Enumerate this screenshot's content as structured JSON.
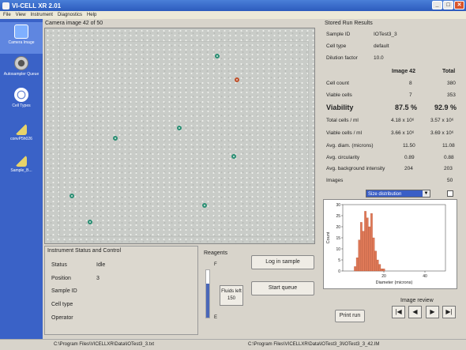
{
  "window": {
    "title": "VI-CELL XR 2.01"
  },
  "menu": [
    "File",
    "View",
    "Instrument",
    "Diagnostics",
    "Help"
  ],
  "sidebar": {
    "items": [
      {
        "label": "Camera Image",
        "color": "#7fb0ff"
      },
      {
        "label": "Autosampler Queue",
        "color": "#c9c9c9"
      },
      {
        "label": "Cell Types",
        "color": "#f0f0f0"
      },
      {
        "label": "convP5h026",
        "color": "#e8d36a"
      },
      {
        "label": "Sample_B...",
        "color": "#e8d36a"
      }
    ]
  },
  "camera": {
    "label": "Camera image 42 of 50"
  },
  "status": {
    "title": "Instrument Status and Control",
    "rows": [
      {
        "label": "Status",
        "value": "Idle"
      },
      {
        "label": "Position",
        "value": "3"
      },
      {
        "label": "Sample ID",
        "value": ""
      },
      {
        "label": "Cell type",
        "value": ""
      },
      {
        "label": "Operator",
        "value": ""
      }
    ]
  },
  "reagents": {
    "title": "Reagents",
    "full_mark": "F",
    "empty_mark": "E",
    "fluids_label": "Fluids left",
    "fluids_value": "150",
    "fluid_level": 0.72
  },
  "buttons": {
    "login": "Log in sample",
    "start": "Start queue",
    "print": "Print run"
  },
  "results": {
    "title": "Stored Run Results",
    "sample_id_label": "Sample ID",
    "sample_id": "IOTest3_3",
    "cell_type_label": "Cell type",
    "cell_type": "default",
    "dilution_label": "Dilution factor",
    "dilution": "10.0",
    "col_image": "Image 42",
    "col_total": "Total",
    "rows": [
      {
        "label": "Cell count",
        "image": "8",
        "total": "380"
      },
      {
        "label": "Viable cells",
        "image": "7",
        "total": "353"
      }
    ],
    "viability": {
      "label": "Viability",
      "image": "87.5 %",
      "total": "92.9 %"
    },
    "rows2": [
      {
        "label": "Total cells / ml",
        "image": "4.18 x 10⁶",
        "total": "3.57 x 10⁶"
      },
      {
        "label": "Viable cells / ml",
        "image": "3.66 x 10⁶",
        "total": "3.69 x 10⁶"
      },
      {
        "label": "Avg. diam. (microns)",
        "image": "11.50",
        "total": "11.08"
      },
      {
        "label": "Avg. circularity",
        "image": "0.89",
        "total": "0.88"
      },
      {
        "label": "Avg. background intensity",
        "image": "204",
        "total": "203"
      },
      {
        "label": "Images",
        "image": "",
        "total": "50"
      }
    ]
  },
  "histogram": {
    "selector": "Size distribution",
    "arrow": "▼"
  },
  "chart_data": {
    "type": "bar",
    "xlabel": "Diameter (microns)",
    "ylabel": "Count",
    "xlim": [
      0,
      50
    ],
    "ylim": [
      0,
      30
    ],
    "xticks": [
      20,
      40
    ],
    "yticks": [
      0,
      5,
      10,
      15,
      20,
      25,
      30
    ],
    "x": [
      6,
      7,
      8,
      9,
      10,
      11,
      12,
      13,
      14,
      15,
      16,
      17,
      18,
      19,
      20
    ],
    "values": [
      2,
      6,
      14,
      22,
      18,
      27,
      24,
      20,
      26,
      15,
      9,
      5,
      3,
      1,
      1
    ],
    "color": "#e07a58"
  },
  "review": {
    "title": "Image review",
    "controls": [
      "|◀",
      "◀",
      "▶",
      "▶|"
    ]
  },
  "statusbar": {
    "left": "C:\\Program Files\\VICELLXR\\Data\\IOTest3_3.txt",
    "right": "C:\\Program Files\\VICELLXR\\Data\\IOTest3_3\\IOTest3_3_42.IM"
  }
}
